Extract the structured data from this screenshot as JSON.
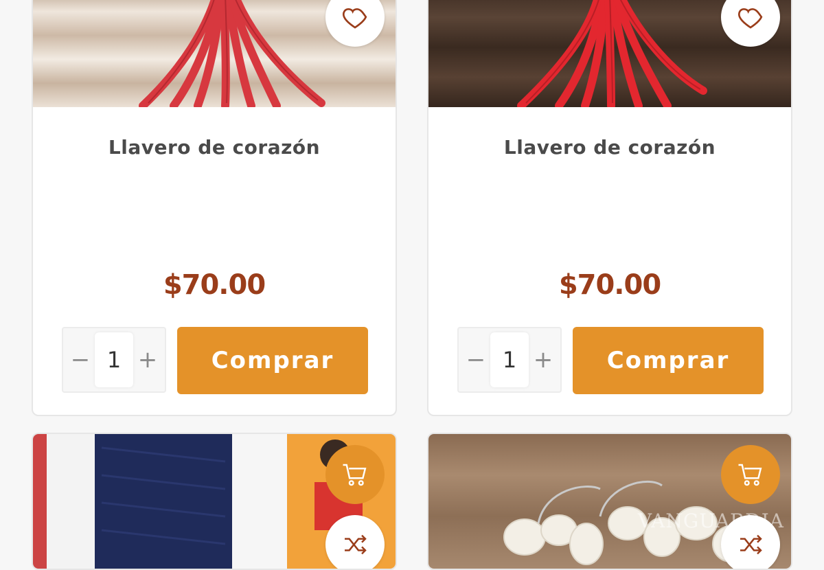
{
  "products": [
    {
      "title": "Llavero de corazón",
      "price": "$70.00",
      "quantity": "1",
      "buy_label": "Comprar",
      "minus": "−",
      "plus": "+"
    },
    {
      "title": "Llavero de corazón",
      "price": "$70.00",
      "quantity": "1",
      "buy_label": "Comprar",
      "minus": "−",
      "plus": "+"
    }
  ],
  "bottom_cards": [
    {
      "icons": [
        "cart-icon",
        "shuffle-icon"
      ]
    },
    {
      "icons": [
        "cart-icon",
        "shuffle-icon"
      ],
      "watermark": "VANGUARDIA"
    }
  ],
  "colors": {
    "accent": "#e49229",
    "price": "#9a3d1a",
    "title": "#4a4a4a"
  }
}
